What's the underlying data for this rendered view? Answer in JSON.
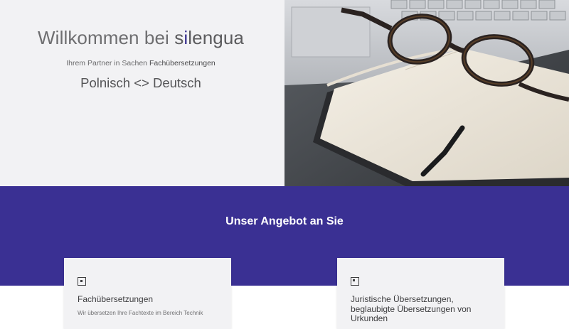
{
  "hero": {
    "title_prefix": "Willkommen bei ",
    "brand_s": "s",
    "brand_i": "i",
    "brand_rest": "lengua",
    "subtitle_prefix": "Ihrem Partner in Sachen ",
    "subtitle_bold": "Fachübersetzungen",
    "languages": "Polnisch <> Deutsch",
    "image_alt": "glasses-on-notebook-photo"
  },
  "offer": {
    "title": "Unser Angebot an Sie",
    "cards": [
      {
        "icon": "square-dot-icon",
        "heading": "Fachübersetzungen",
        "text": "Wir übersetzen Ihre Fachtexte im Bereich Technik"
      },
      {
        "icon": "square-dot-icon",
        "heading": "Juristische Übersetzungen, beglaubigte Übersetzungen von Urkunden"
      }
    ]
  },
  "colors": {
    "accent": "#3a3093",
    "hero_bg": "#f2f2f4",
    "card_bg": "#f2f2f4"
  }
}
